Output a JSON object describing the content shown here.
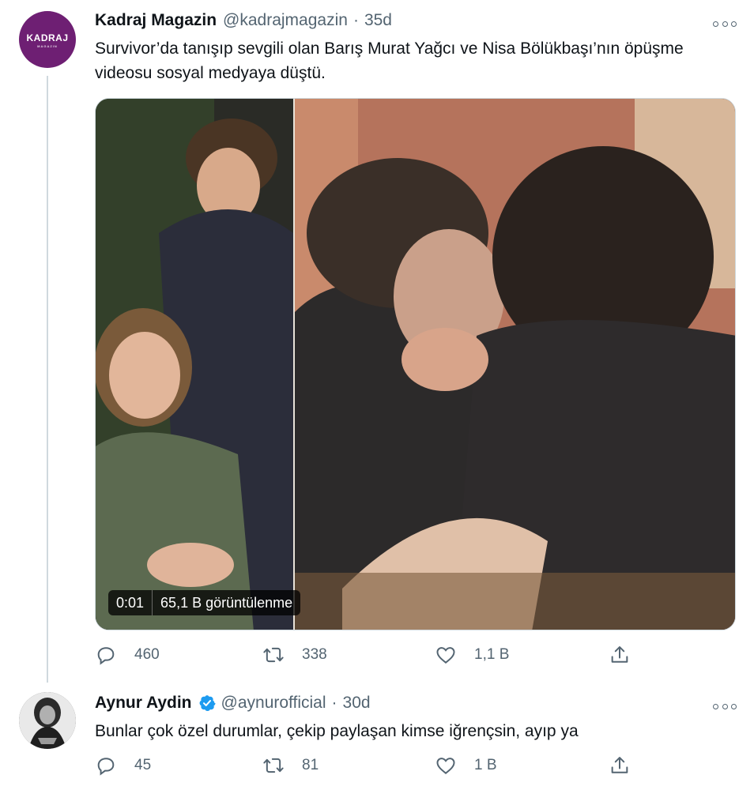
{
  "tweets": [
    {
      "author_name": "Kadraj Magazin",
      "handle": "@kadrajmagazin",
      "separator": "·",
      "age": "35d",
      "avatar_text": "KADRAJ",
      "avatar_subtext": "MAGAZIN",
      "text": "Survivor’da tanışıp sevgili olan Barış Murat Yağcı ve Nisa Bölükbaşı’nın öpüşme videosu sosyal medyaya düştü.",
      "video_time": "0:01",
      "video_views": "65,1 B görüntülenme",
      "replies": "460",
      "retweets": "338",
      "likes": "1,1 B"
    },
    {
      "author_name": "Aynur Aydin",
      "verified": true,
      "handle": "@aynurofficial",
      "separator": "·",
      "age": "30d",
      "text": "Bunlar çok özel durumlar, çekip paylaşan kimse iğrençsin, ayıp ya",
      "replies": "45",
      "retweets": "81",
      "likes": "1 B"
    }
  ],
  "colors": {
    "text_primary": "#0f1419",
    "text_secondary": "#536471",
    "verified_blue": "#1d9bf0",
    "kadraj_purple": "#6e1f73",
    "border": "#cfd9de"
  },
  "icons": [
    "more-icon",
    "reply-icon",
    "retweet-icon",
    "like-icon",
    "share-icon",
    "verified-icon"
  ]
}
